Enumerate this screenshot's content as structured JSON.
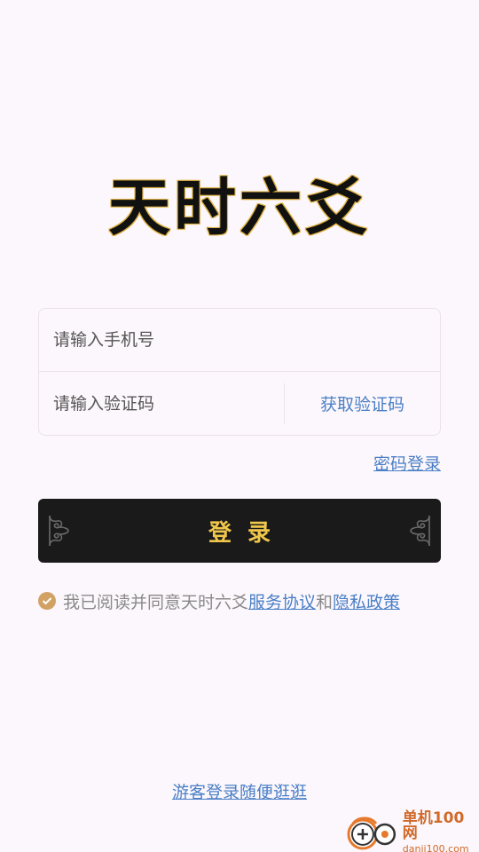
{
  "app": {
    "title": "天时六爻"
  },
  "form": {
    "phone_placeholder": "请输入手机号",
    "code_placeholder": "请输入验证码",
    "get_code_label": "获取验证码"
  },
  "password_login_label": "密码登录",
  "login_button_label": "登录",
  "agreement": {
    "prefix": "我已阅读并同意天时六爻",
    "service_link": "服务协议",
    "conjunction": "和",
    "privacy_link": "隐私政策",
    "checked": true
  },
  "guest_login_label": "游客登录随便逛逛",
  "watermark": {
    "name": "单机100网",
    "url": "danji100.com"
  },
  "colors": {
    "background": "#fcf7fc",
    "link": "#4a7fc6",
    "button_bg": "#1b1a1b",
    "button_text": "#f0c74a",
    "check": "#d2a264"
  }
}
